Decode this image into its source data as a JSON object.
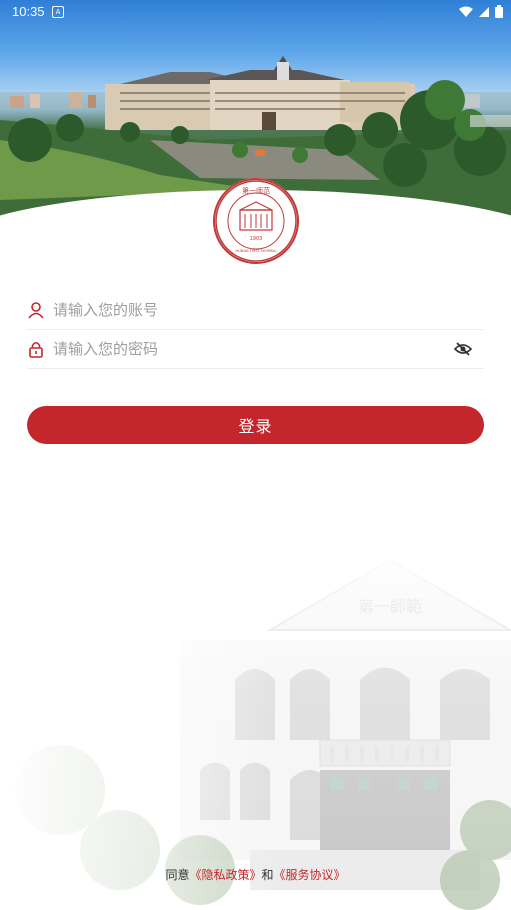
{
  "status_bar": {
    "time": "10:35",
    "notification_badge": "A"
  },
  "hero": {
    "logo_alt": "Hunan First Normal University seal",
    "logo_top_text": "第一师范",
    "logo_ring_text": "HUNAN FIRST NORMAL UNIVERSITY",
    "logo_year": "1903"
  },
  "form": {
    "account_placeholder": "请输入您的账号",
    "password_placeholder": "请输入您的密码",
    "login_label": "登录"
  },
  "agreement": {
    "prefix": "同意",
    "privacy_link": "《隐私政策》",
    "and": "和",
    "service_link": "《服务协议》"
  },
  "colors": {
    "accent": "#c3272b",
    "placeholder": "#9e9e9e"
  },
  "icons": {
    "account": "user-icon",
    "password": "lock-icon",
    "visibility": "eye-off-icon"
  }
}
